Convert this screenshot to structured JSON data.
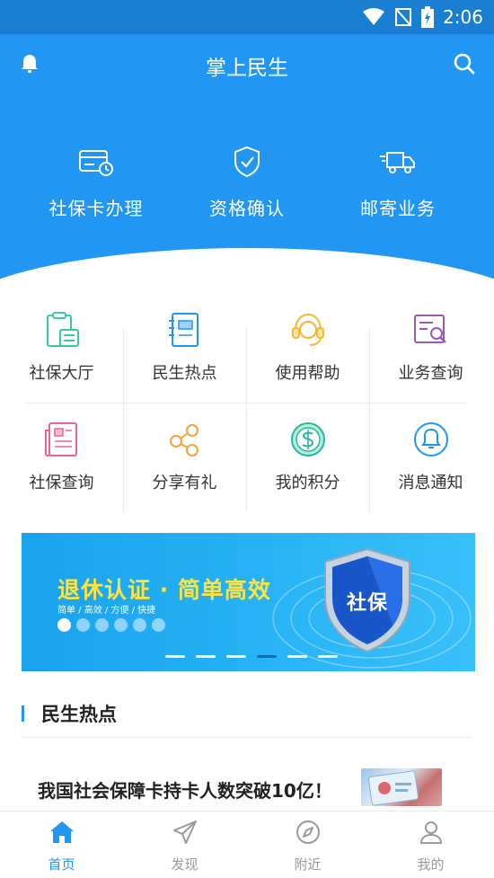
{
  "status": {
    "time": "2:06"
  },
  "header": {
    "title": "掌上民生"
  },
  "quick_actions": [
    {
      "label": "社保卡办理",
      "icon": "card-clock-icon"
    },
    {
      "label": "资格确认",
      "icon": "shield-check-icon"
    },
    {
      "label": "邮寄业务",
      "icon": "truck-icon"
    }
  ],
  "grid": [
    {
      "label": "社保大厅",
      "icon": "clipboard-icon"
    },
    {
      "label": "民生热点",
      "icon": "notebook-icon"
    },
    {
      "label": "使用帮助",
      "icon": "headset-icon"
    },
    {
      "label": "业务查询",
      "icon": "search-document-icon"
    },
    {
      "label": "社保查询",
      "icon": "newspaper-icon"
    },
    {
      "label": "分享有礼",
      "icon": "share-icon"
    },
    {
      "label": "我的积分",
      "icon": "coin-icon"
    },
    {
      "label": "消息通知",
      "icon": "bell-circle-icon"
    }
  ],
  "banner": {
    "title": "退休认证 · 简单高效",
    "subtitle": "简单 / 高效 / 方便 / 快捷",
    "badge": "社保",
    "slide_count": 6,
    "active_slide": 4
  },
  "section": {
    "title": "民生热点"
  },
  "news": [
    {
      "title": "我国社会保障卡持卡人数突破10亿！"
    }
  ],
  "bottom_nav": [
    {
      "label": "首页",
      "icon": "home-icon",
      "active": true
    },
    {
      "label": "发现",
      "icon": "paper-plane-icon",
      "active": false
    },
    {
      "label": "附近",
      "icon": "compass-icon",
      "active": false
    },
    {
      "label": "我的",
      "icon": "user-icon",
      "active": false
    }
  ],
  "colors": {
    "primary": "#2196f3",
    "banner_title": "#ffe53b"
  }
}
